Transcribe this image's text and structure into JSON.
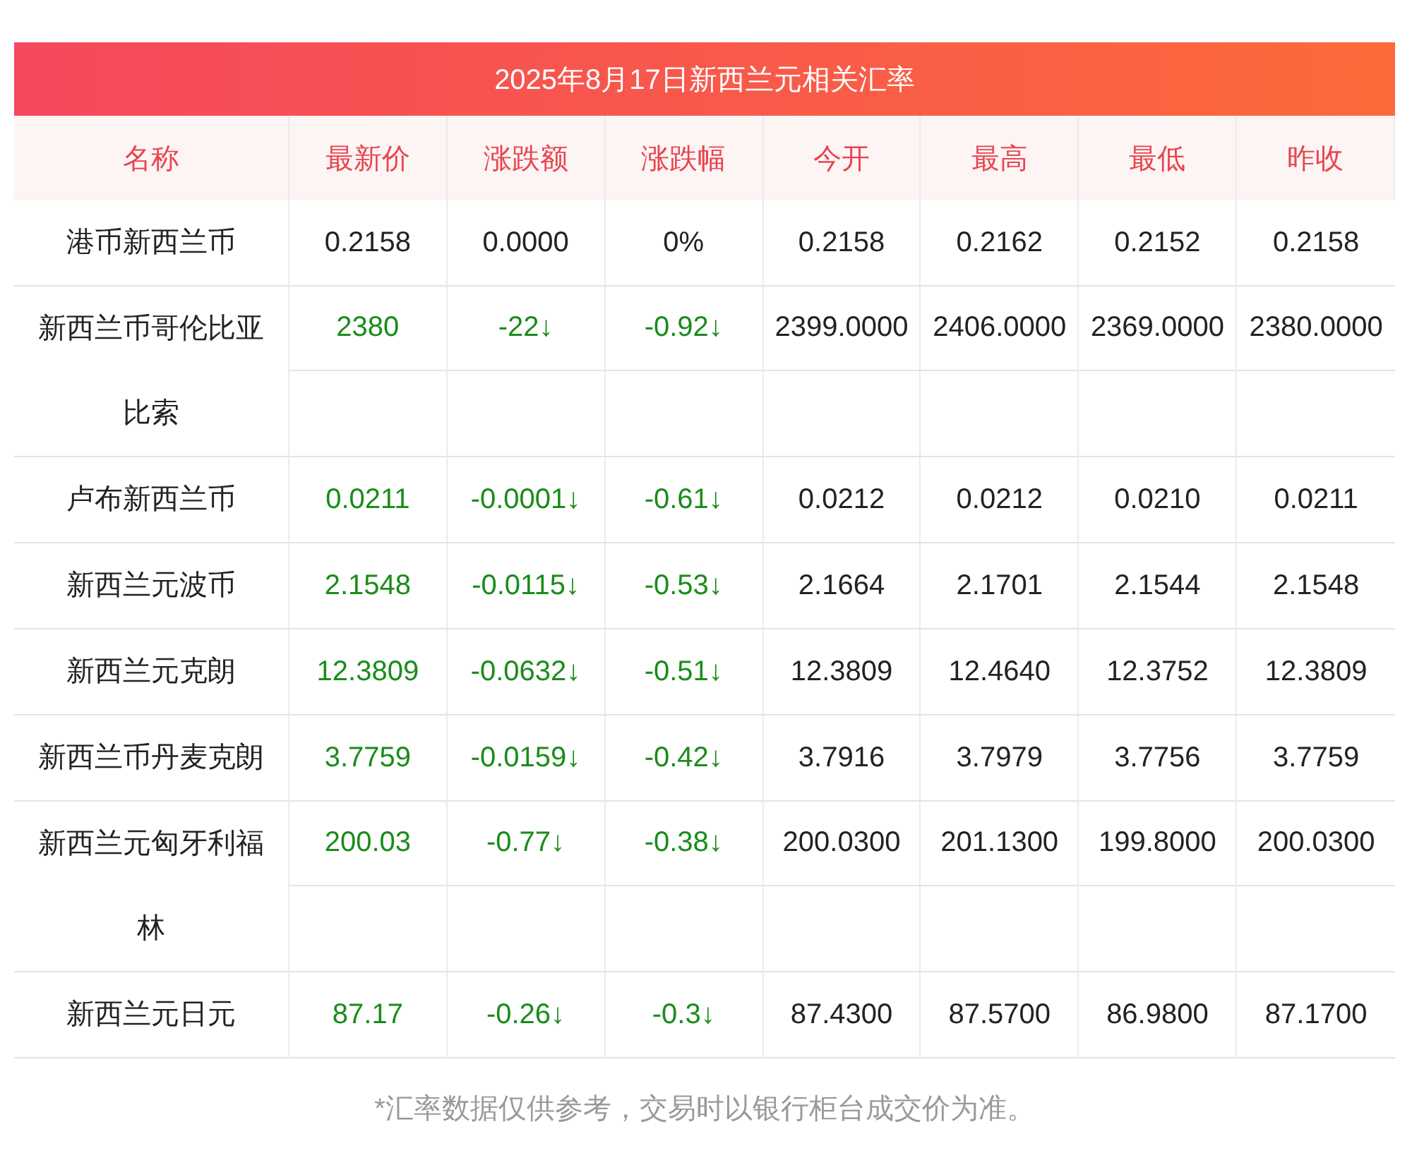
{
  "title": "2025年8月17日新西兰元相关汇率",
  "columns": [
    "名称",
    "最新价",
    "涨跌额",
    "涨跌幅",
    "今开",
    "最高",
    "最低",
    "昨收"
  ],
  "rows": [
    {
      "falling": false,
      "cells": [
        "港币新西兰币",
        "0.2158",
        "0.0000",
        "0%",
        "0.2158",
        "0.2162",
        "0.2152",
        "0.2158"
      ]
    },
    {
      "falling": true,
      "cells": [
        "新西兰币哥伦比亚比索",
        "2380",
        "-22↓",
        "-0.92↓",
        "2399.0000",
        "2406.0000",
        "2369.0000",
        "2380.0000"
      ]
    },
    {
      "falling": true,
      "cells": [
        "卢布新西兰币",
        "0.0211",
        "-0.0001↓",
        "-0.61↓",
        "0.0212",
        "0.0212",
        "0.0210",
        "0.0211"
      ]
    },
    {
      "falling": true,
      "cells": [
        "新西兰元波币",
        "2.1548",
        "-0.0115↓",
        "-0.53↓",
        "2.1664",
        "2.1701",
        "2.1544",
        "2.1548"
      ]
    },
    {
      "falling": true,
      "cells": [
        "新西兰元克朗",
        "12.3809",
        "-0.0632↓",
        "-0.51↓",
        "12.3809",
        "12.4640",
        "12.3752",
        "12.3809"
      ]
    },
    {
      "falling": true,
      "cells": [
        "新西兰币丹麦克朗",
        "3.7759",
        "-0.0159↓",
        "-0.42↓",
        "3.7916",
        "3.7979",
        "3.7756",
        "3.7759"
      ]
    },
    {
      "falling": true,
      "cells": [
        "新西兰元匈牙利福林",
        "200.03",
        "-0.77↓",
        "-0.38↓",
        "200.0300",
        "201.1300",
        "199.8000",
        "200.0300"
      ]
    },
    {
      "falling": true,
      "cells": [
        "新西兰元日元",
        "87.17",
        "-0.26↓",
        "-0.3↓",
        "87.4300",
        "87.5700",
        "86.9800",
        "87.1700"
      ]
    }
  ],
  "note": "*汇率数据仅供参考，交易时以银行柜台成交价为准。"
}
